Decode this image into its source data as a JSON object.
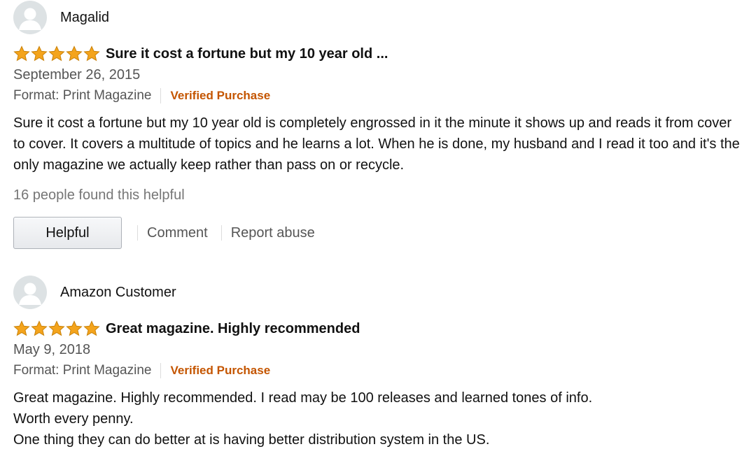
{
  "reviews": [
    {
      "author": "Magalid",
      "rating": 5,
      "title": "Sure it cost a fortune but my 10 year old ...",
      "date": "September 26, 2015",
      "format": "Format: Print Magazine",
      "verified": "Verified Purchase",
      "body": [
        "Sure it cost a fortune but my 10 year old is completely engrossed in it the minute it shows up and reads it from cover to cover. It covers a multitude of topics and he learns a lot. When he is done, my husband and I read it too and it's the only magazine we actually keep rather than pass on or recycle."
      ],
      "helpful_count": "16 people found this helpful",
      "actions": {
        "helpful": "Helpful",
        "comment": "Comment",
        "report": "Report abuse"
      }
    },
    {
      "author": "Amazon Customer",
      "rating": 5,
      "title": "Great magazine. Highly recommended",
      "date": "May 9, 2018",
      "format": "Format: Print Magazine",
      "verified": "Verified Purchase",
      "body": [
        "Great magazine. Highly recommended. I read may be 100 releases and learned tones of info.",
        "Worth every penny.",
        "One thing they can do better at is having better distribution system in the US."
      ]
    }
  ],
  "colors": {
    "star": "#f4a41c",
    "verified": "#c45500",
    "muted": "#555555",
    "avatar_bg": "#dde2e4"
  },
  "icons": {
    "avatar": "user-avatar-icon",
    "star": "star-icon"
  }
}
